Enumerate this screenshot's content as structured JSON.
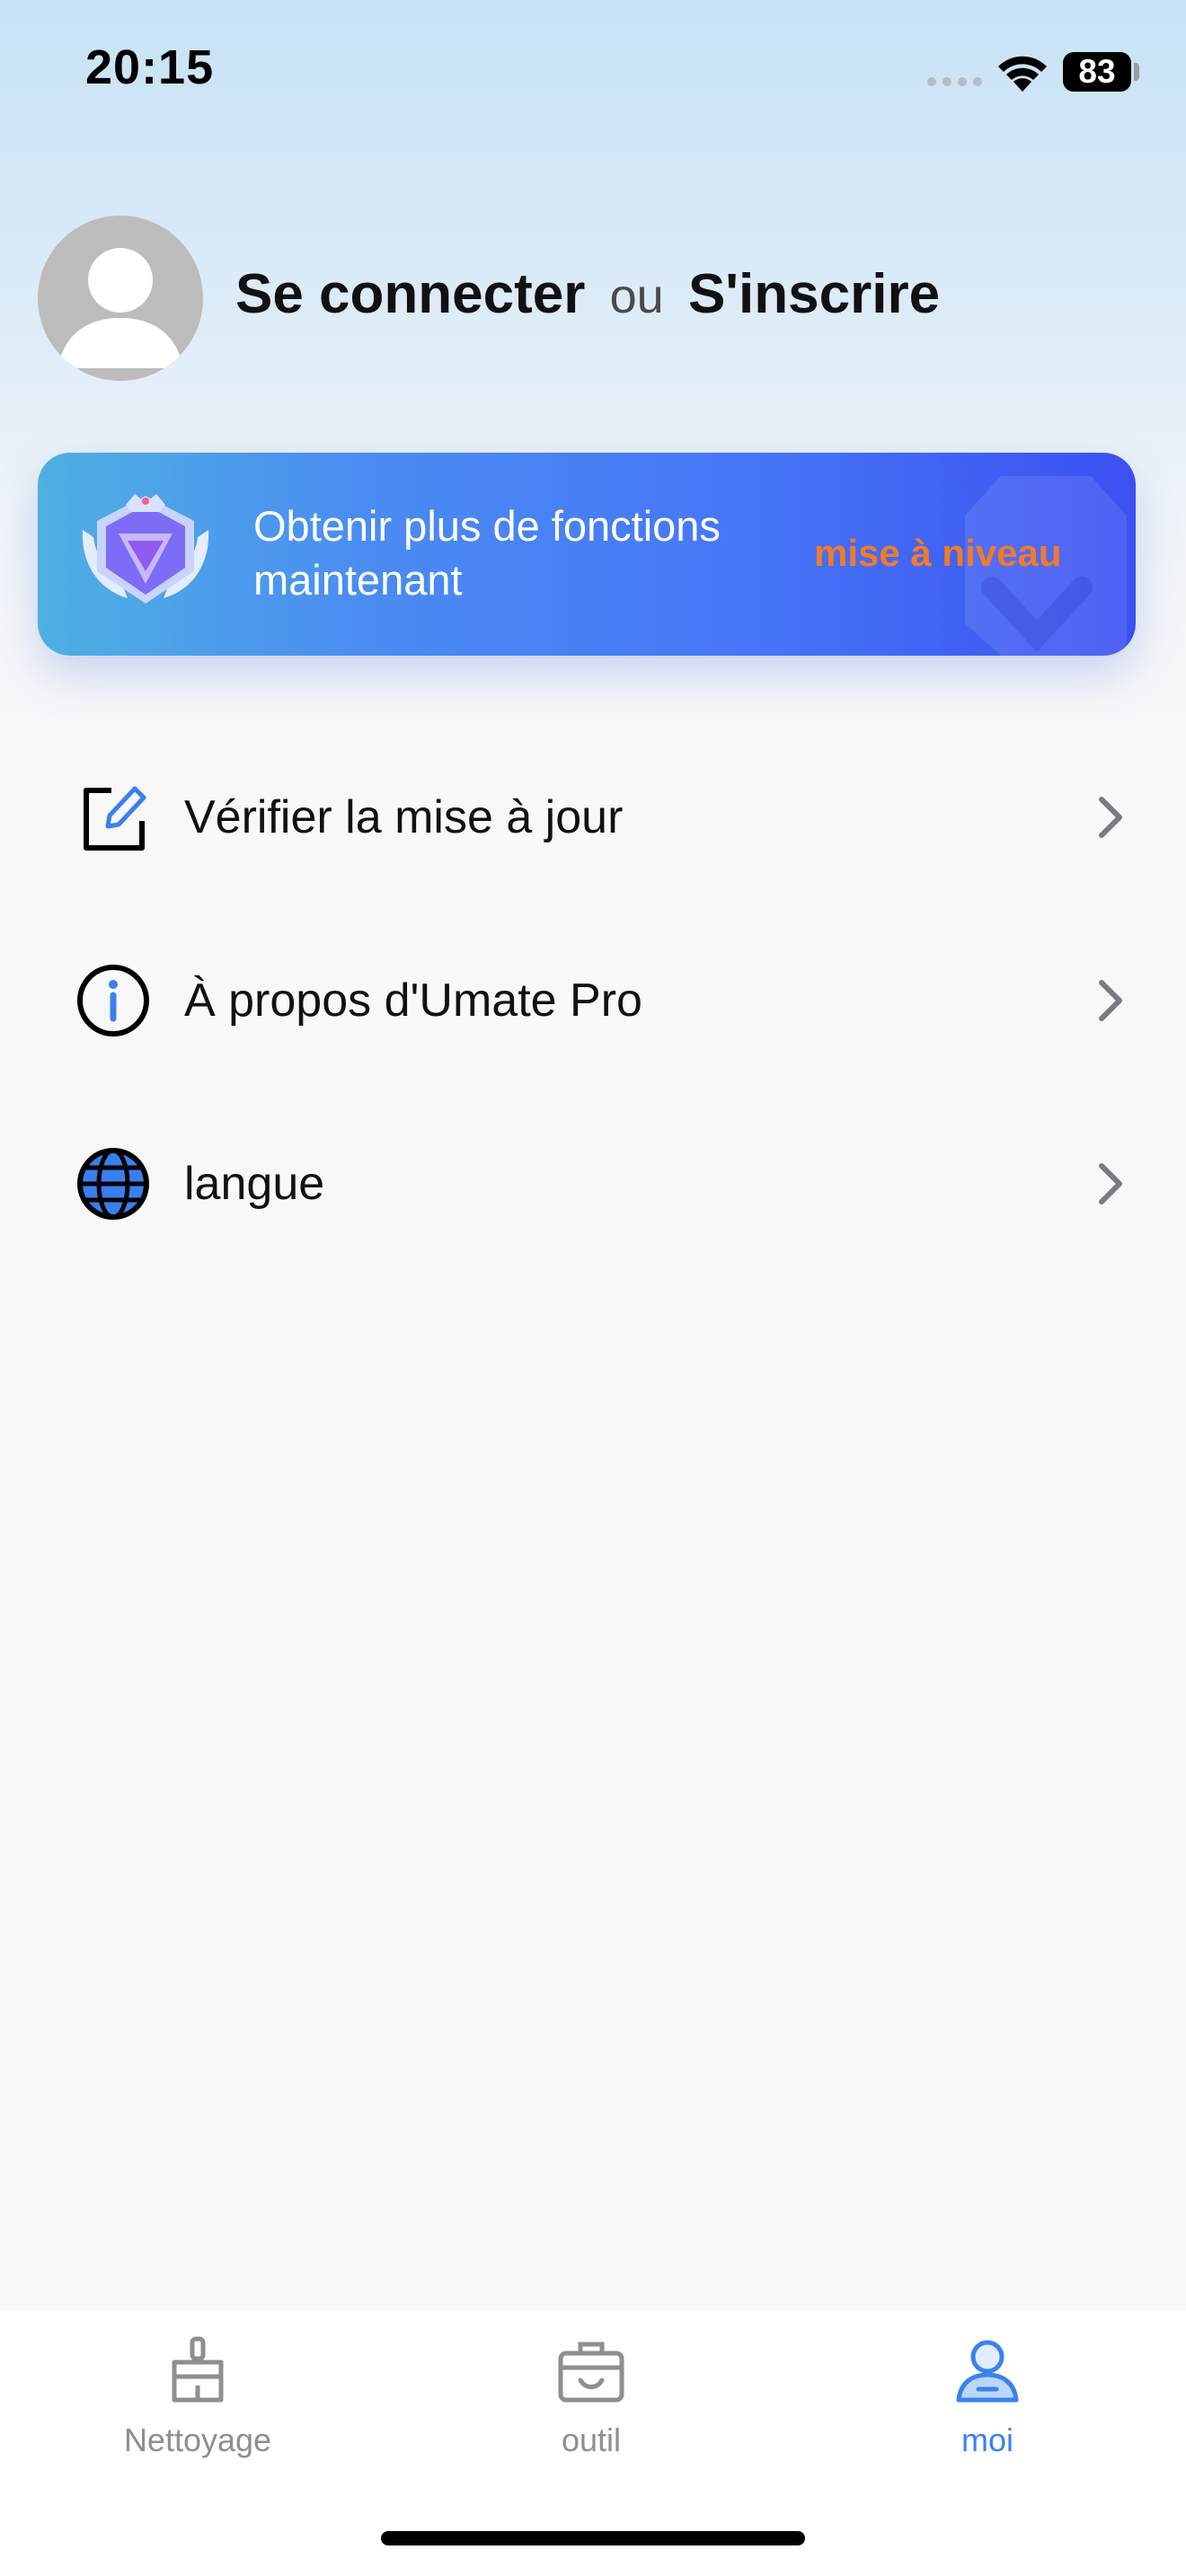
{
  "status_bar": {
    "time": "20:15",
    "battery": "83",
    "icons": [
      "signal-icon",
      "wifi-icon",
      "battery-icon"
    ]
  },
  "profile": {
    "avatar_icon": "user-avatar-icon",
    "login_label": "Se connecter",
    "or_label": "ou",
    "signup_label": "S'inscrire"
  },
  "banner": {
    "badge_icon": "premium-crown-badge-icon",
    "text": "Obtenir plus de fonctions maintenant",
    "button_label": "mise à niveau",
    "button_color": "#f27a2a"
  },
  "menu": {
    "items": [
      {
        "label": "Vérifier la mise à jour",
        "icon": "edit-icon"
      },
      {
        "label": "À propos d'Umate Pro",
        "icon": "info-icon"
      },
      {
        "label": "langue",
        "icon": "globe-icon"
      }
    ]
  },
  "tabs": {
    "items": [
      {
        "label": "Nettoyage",
        "icon": "broom-icon",
        "active": false
      },
      {
        "label": "outil",
        "icon": "toolbox-icon",
        "active": false
      },
      {
        "label": "moi",
        "icon": "person-icon",
        "active": true
      }
    ],
    "active_color": "#3a82ee",
    "inactive_color": "#8e8e93"
  }
}
